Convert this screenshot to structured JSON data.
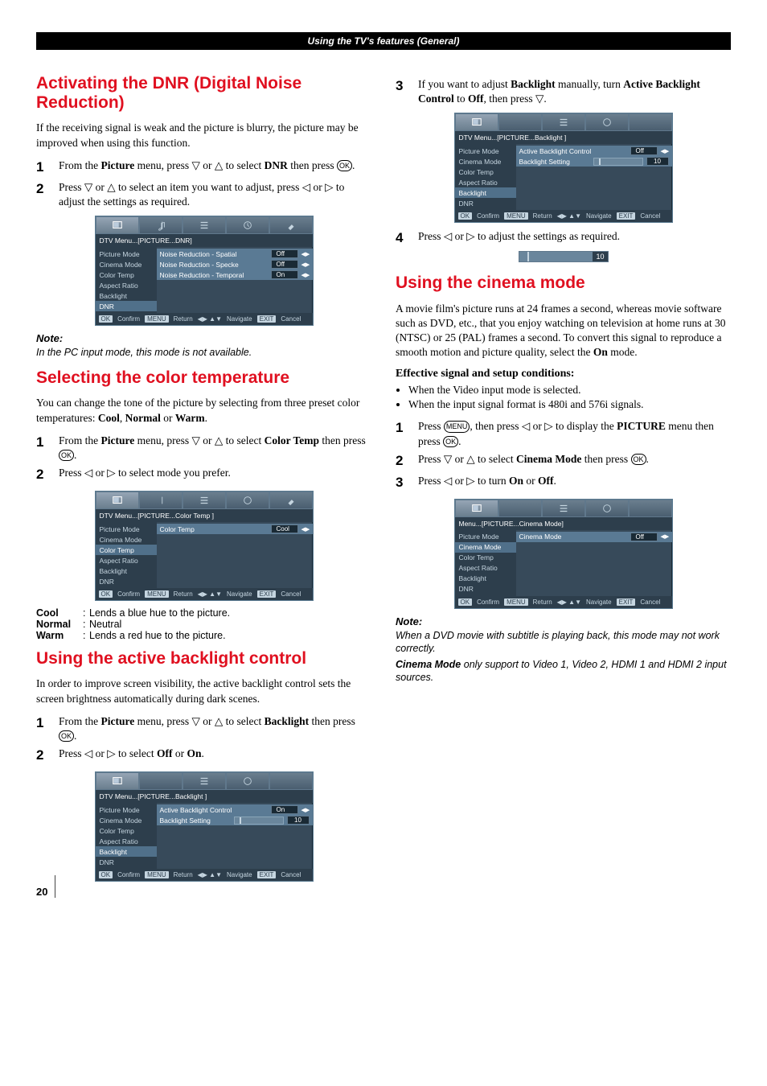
{
  "header": "Using the TV's features (General)",
  "pageNumber": "20",
  "left": {
    "dnr": {
      "title": "Activating the DNR (Digital Noise Reduction)",
      "intro": "If the receiving signal is weak and the picture is blurry, the picture may be improved when using this function.",
      "step1_a": "From the ",
      "step1_b": "Picture",
      "step1_c": " menu, press ▽ or △ to select ",
      "step1_d": "DNR",
      "step1_e": " then press ",
      "step2_a": "Press ▽ or △ to select an item you want to adjust, press ◁ or ▷ to adjust the settings as required.",
      "note_hd": "Note:",
      "note_body": "In the PC input mode, this mode is not available."
    },
    "color": {
      "title": "Selecting the color temperature",
      "intro_a": "You can change the tone of the picture by selecting from three preset color temperatures: ",
      "intro_b": "Cool",
      "intro_c": ", ",
      "intro_d": "Normal",
      "intro_e": " or ",
      "intro_f": "Warm",
      "intro_g": ".",
      "step1_a": "From the ",
      "step1_b": "Picture",
      "step1_c": " menu, press ▽ or △ to select ",
      "step1_d": "Color Temp",
      "step1_e": " then press ",
      "step2": "Press ◁ or ▷ to select mode you prefer.",
      "desc": {
        "cool_k": "Cool",
        "cool_v": "Lends a blue hue to the picture.",
        "norm_k": "Normal",
        "norm_v": "Neutral",
        "warm_k": "Warm",
        "warm_v": "Lends a red hue to the picture."
      }
    },
    "backlight": {
      "title": "Using the active backlight control",
      "intro": "In order to improve screen visibility, the active backlight control sets the screen brightness automatically during dark scenes.",
      "step1_a": "From the ",
      "step1_b": "Picture",
      "step1_c": " menu, press ▽ or △ to select ",
      "step1_d": "Backlight",
      "step1_e": " then press ",
      "step2_a": "Press ◁ or ▷ to select ",
      "step2_b": "Off",
      "step2_c": " or ",
      "step2_d": "On",
      "step2_e": "."
    }
  },
  "right": {
    "step3_a": "If you want to adjust ",
    "step3_b": "Backlight",
    "step3_c": " manually, turn ",
    "step3_d": "Active Backlight Control",
    "step3_e": " to ",
    "step3_f": "Off",
    "step3_g": ", then press ▽.",
    "step4": "Press ◁ or ▷ to adjust the settings as required.",
    "slider_val": "10",
    "cinema": {
      "title": "Using the cinema mode",
      "intro_a": "A movie film's picture runs at 24 frames a second, whereas movie software such as DVD, etc., that you enjoy watching on television at home runs at 30 (NTSC) or 25 (PAL) frames a second. To convert this signal to reproduce a smooth motion and picture quality, select the ",
      "intro_b": "On",
      "intro_c": " mode.",
      "eff_hd": "Effective signal and setup conditions:",
      "b1": "When the Video input mode is selected.",
      "b2": "When the input signal format is 480i and 576i signals.",
      "step1_a": "Press ",
      "step1_b": ", then press ◁ or ▷ to display the ",
      "step1_c": "PICTURE",
      "step1_d": " menu then press ",
      "step2_a": "Press ▽ or △ to select ",
      "step2_b": "Cinema Mode",
      "step2_c": " then press ",
      "step3_a": "Press ◁ or ▷ to turn ",
      "step3_b": "On",
      "step3_c": " or ",
      "step3_d": "Off",
      "step3_e": ".",
      "note_hd": "Note:",
      "note1": "When a DVD movie with subtitle is playing back, this mode may not work correctly.",
      "note2_a": "Cinema Mode",
      "note2_b": " only support to Video 1, Video 2, HDMI 1 and HDMI 2 input sources."
    }
  },
  "menus": {
    "sideItems": [
      "Picture Mode",
      "Cinema Mode",
      "Color Temp",
      "Aspect Ratio",
      "Backlight",
      "DNR"
    ],
    "dnr": {
      "crumb": "DTV Menu...[PICTURE...DNR]",
      "rows": [
        {
          "lbl": "Noise Reduction - Spatial",
          "val": "Off"
        },
        {
          "lbl": "Noise Reduction - Specke",
          "val": "Off"
        },
        {
          "lbl": "Noise Reduction - Temporal",
          "val": "On"
        }
      ]
    },
    "color": {
      "crumb": "DTV Menu...[PICTURE...Color Temp ]",
      "row": {
        "lbl": "Color Temp",
        "val": "Cool"
      }
    },
    "bl_on": {
      "crumb": "DTV Menu...[PICTURE...Backlight ]",
      "rows": [
        {
          "lbl": "Active Backlight Control",
          "val": "On"
        },
        {
          "lbl": "Backlight Setting",
          "slider": true,
          "num": "10"
        }
      ]
    },
    "bl_off": {
      "crumb": "DTV Menu...[PICTURE...Backlight ]",
      "rows": [
        {
          "lbl": "Active Backlight Control",
          "val": "Off"
        },
        {
          "lbl": "Backlight Setting",
          "slider": true,
          "num": "10"
        }
      ]
    },
    "cinema": {
      "crumb": "Menu...[PICTURE...Cinema Mode]",
      "row": {
        "lbl": "Cinema Mode",
        "val": "Off"
      }
    },
    "footer": {
      "ok": "OK",
      "confirm": "Confirm",
      "menu": "MENU",
      "return": "Return",
      "nav": "Navigate",
      "exit": "EXIT",
      "cancel": "Cancel",
      "arrows": "◀▶ ▲▼"
    }
  }
}
